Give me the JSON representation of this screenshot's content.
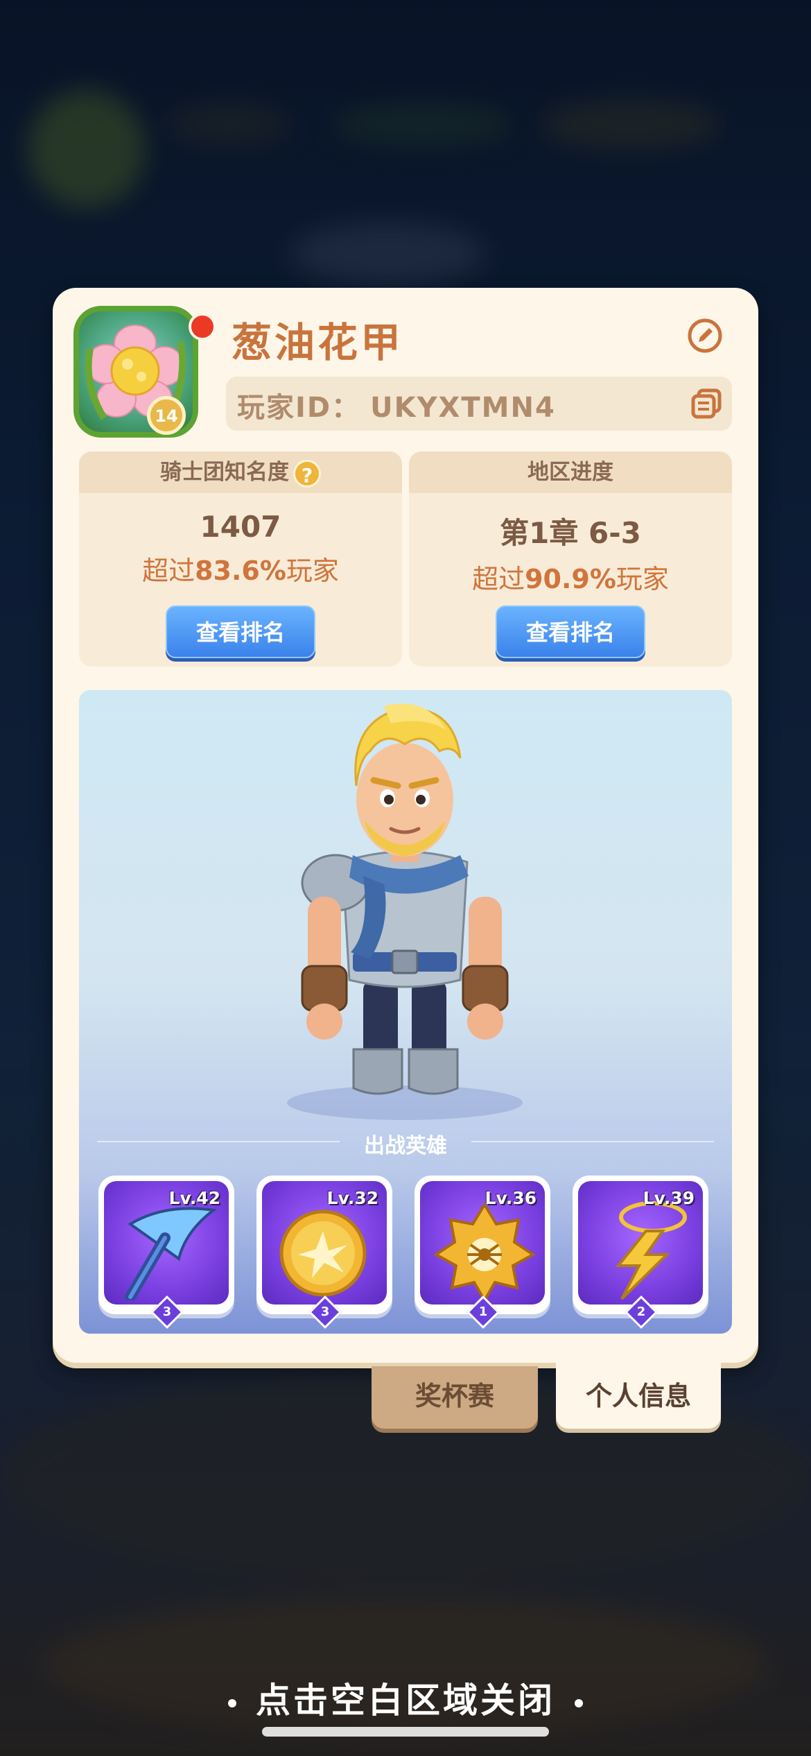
{
  "player": {
    "name": "葱油花甲",
    "id_label": "玩家ID：",
    "id_value": "UKYXTMN4",
    "level": "14"
  },
  "stats": {
    "fame": {
      "title": "骑士团知名度",
      "help_icon": "?",
      "value": "1407",
      "percentile_prefix": "超过",
      "percentile_value": "83.6%",
      "percentile_suffix": "玩家",
      "button": "查看排名"
    },
    "progress": {
      "title": "地区进度",
      "value": "第1章 6-3",
      "percentile_prefix": "超过",
      "percentile_value": "90.9%",
      "percentile_suffix": "玩家",
      "button": "查看排名"
    }
  },
  "deploy": {
    "title": "出战英雄",
    "heroes": [
      {
        "icon": "crossbow-icon",
        "level": "Lv.42",
        "stars": "3"
      },
      {
        "icon": "golden-shield-icon",
        "level": "Lv.32",
        "stars": "3"
      },
      {
        "icon": "spider-medal-icon",
        "level": "Lv.36",
        "stars": "1"
      },
      {
        "icon": "lightning-amulet-icon",
        "level": "Lv.39",
        "stars": "2"
      }
    ]
  },
  "tabs": {
    "trophy": "奖杯赛",
    "profile": "个人信息"
  },
  "close_hint": "点击空白区域关闭",
  "colors": {
    "panel": "#fdf6e9",
    "name": "#c9743d",
    "button_blue": "#3a82ea",
    "hero_card": "#7a3fe0"
  }
}
